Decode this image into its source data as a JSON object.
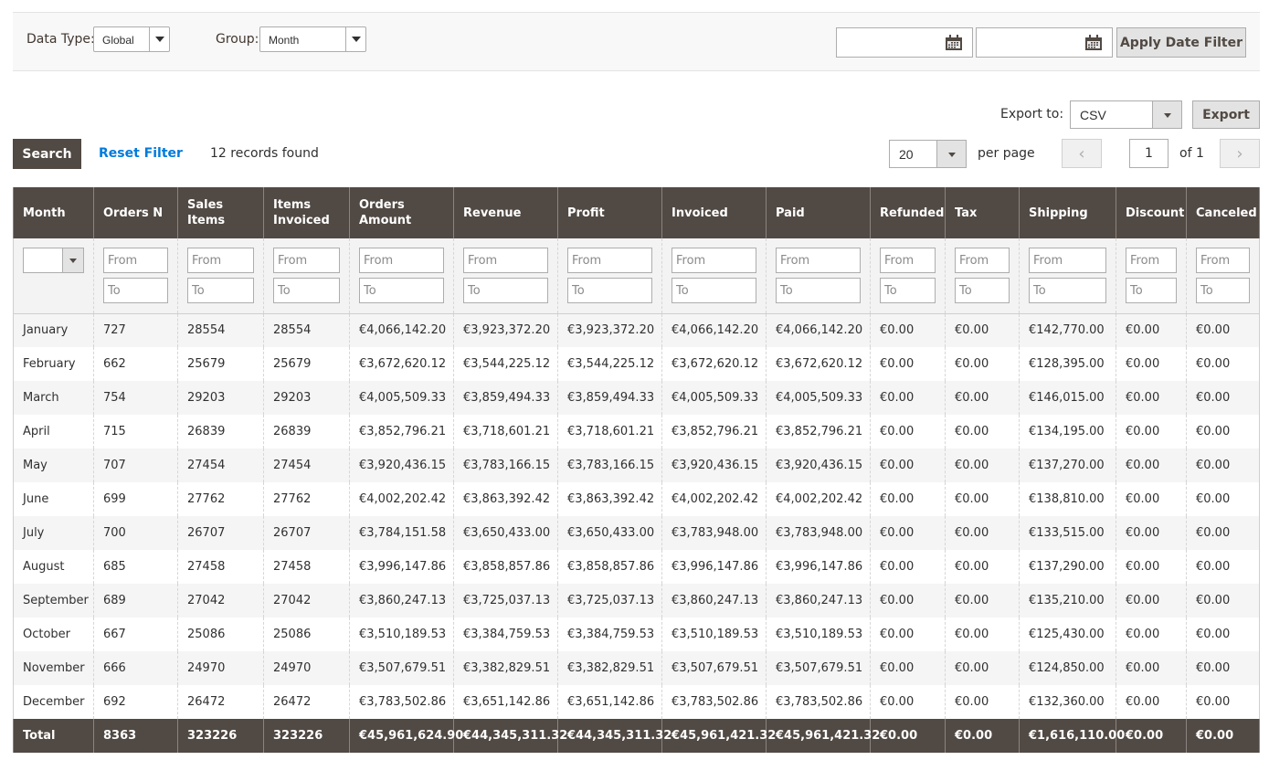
{
  "filter_bar": {
    "data_type_label": "Data Type:",
    "data_type_value": "Global",
    "group_label": "Group:",
    "group_value": "Month",
    "date_from_value": "",
    "date_to_value": "",
    "apply_label": "Apply Date Filter",
    "calendar_icon": "calendar-icon"
  },
  "export": {
    "label": "Export to:",
    "format": "CSV",
    "button_label": "Export"
  },
  "actions": {
    "search_label": "Search",
    "reset_label": "Reset Filter",
    "records_found": "12 records found"
  },
  "pagination": {
    "per_page_value": "20",
    "per_page_label": "per page",
    "prev_icon": "‹",
    "next_icon": "›",
    "current_page": "1",
    "of_total": "of 1"
  },
  "table": {
    "columns": [
      "Month",
      "Orders N",
      "Sales Items",
      "Items Invoiced",
      "Orders Amount",
      "Revenue",
      "Profit",
      "Invoiced",
      "Paid",
      "Refunded",
      "Tax",
      "Shipping",
      "Discount",
      "Canceled"
    ],
    "filter_from_placeholder": "From",
    "filter_to_placeholder": "To",
    "rows": [
      [
        "January",
        "727",
        "28554",
        "28554",
        "€4,066,142.20",
        "€3,923,372.20",
        "€3,923,372.20",
        "€4,066,142.20",
        "€4,066,142.20",
        "€0.00",
        "€0.00",
        "€142,770.00",
        "€0.00",
        "€0.00"
      ],
      [
        "February",
        "662",
        "25679",
        "25679",
        "€3,672,620.12",
        "€3,544,225.12",
        "€3,544,225.12",
        "€3,672,620.12",
        "€3,672,620.12",
        "€0.00",
        "€0.00",
        "€128,395.00",
        "€0.00",
        "€0.00"
      ],
      [
        "March",
        "754",
        "29203",
        "29203",
        "€4,005,509.33",
        "€3,859,494.33",
        "€3,859,494.33",
        "€4,005,509.33",
        "€4,005,509.33",
        "€0.00",
        "€0.00",
        "€146,015.00",
        "€0.00",
        "€0.00"
      ],
      [
        "April",
        "715",
        "26839",
        "26839",
        "€3,852,796.21",
        "€3,718,601.21",
        "€3,718,601.21",
        "€3,852,796.21",
        "€3,852,796.21",
        "€0.00",
        "€0.00",
        "€134,195.00",
        "€0.00",
        "€0.00"
      ],
      [
        "May",
        "707",
        "27454",
        "27454",
        "€3,920,436.15",
        "€3,783,166.15",
        "€3,783,166.15",
        "€3,920,436.15",
        "€3,920,436.15",
        "€0.00",
        "€0.00",
        "€137,270.00",
        "€0.00",
        "€0.00"
      ],
      [
        "June",
        "699",
        "27762",
        "27762",
        "€4,002,202.42",
        "€3,863,392.42",
        "€3,863,392.42",
        "€4,002,202.42",
        "€4,002,202.42",
        "€0.00",
        "€0.00",
        "€138,810.00",
        "€0.00",
        "€0.00"
      ],
      [
        "July",
        "700",
        "26707",
        "26707",
        "€3,784,151.58",
        "€3,650,433.00",
        "€3,650,433.00",
        "€3,783,948.00",
        "€3,783,948.00",
        "€0.00",
        "€0.00",
        "€133,515.00",
        "€0.00",
        "€0.00"
      ],
      [
        "August",
        "685",
        "27458",
        "27458",
        "€3,996,147.86",
        "€3,858,857.86",
        "€3,858,857.86",
        "€3,996,147.86",
        "€3,996,147.86",
        "€0.00",
        "€0.00",
        "€137,290.00",
        "€0.00",
        "€0.00"
      ],
      [
        "September",
        "689",
        "27042",
        "27042",
        "€3,860,247.13",
        "€3,725,037.13",
        "€3,725,037.13",
        "€3,860,247.13",
        "€3,860,247.13",
        "€0.00",
        "€0.00",
        "€135,210.00",
        "€0.00",
        "€0.00"
      ],
      [
        "October",
        "667",
        "25086",
        "25086",
        "€3,510,189.53",
        "€3,384,759.53",
        "€3,384,759.53",
        "€3,510,189.53",
        "€3,510,189.53",
        "€0.00",
        "€0.00",
        "€125,430.00",
        "€0.00",
        "€0.00"
      ],
      [
        "November",
        "666",
        "24970",
        "24970",
        "€3,507,679.51",
        "€3,382,829.51",
        "€3,382,829.51",
        "€3,507,679.51",
        "€3,507,679.51",
        "€0.00",
        "€0.00",
        "€124,850.00",
        "€0.00",
        "€0.00"
      ],
      [
        "December",
        "692",
        "26472",
        "26472",
        "€3,783,502.86",
        "€3,651,142.86",
        "€3,651,142.86",
        "€3,783,502.86",
        "€3,783,502.86",
        "€0.00",
        "€0.00",
        "€132,360.00",
        "€0.00",
        "€0.00"
      ]
    ],
    "totals": [
      "Total",
      "8363",
      "323226",
      "323226",
      "€45,961,624.90",
      "€44,345,311.32",
      "€44,345,311.32",
      "€45,961,421.32",
      "€45,961,421.32",
      "€0.00",
      "€0.00",
      "€1,616,110.00",
      "€0.00",
      "€0.00"
    ]
  }
}
